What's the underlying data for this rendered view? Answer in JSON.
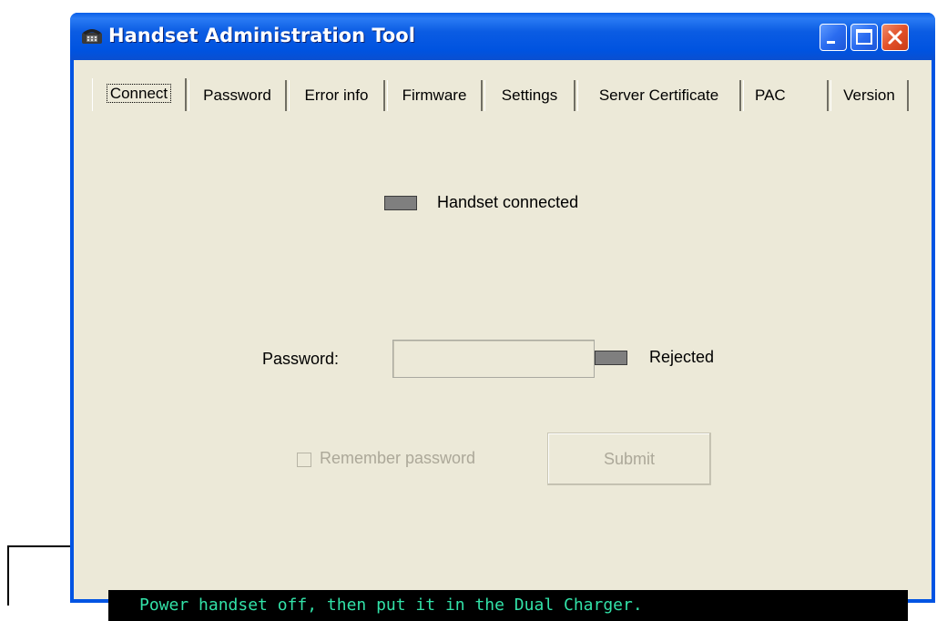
{
  "window": {
    "title": "Handset Administration Tool",
    "icon": "telephone-icon",
    "controls": [
      "minimize-icon",
      "maximize-icon",
      "close-icon"
    ]
  },
  "tabs": [
    {
      "label": "Connect",
      "active": true
    },
    {
      "label": "Password",
      "active": false
    },
    {
      "label": "Error info",
      "active": false
    },
    {
      "label": "Firmware",
      "active": false
    },
    {
      "label": "Settings",
      "active": false
    },
    {
      "label": "Server Certificate",
      "active": false
    },
    {
      "label": "PAC",
      "active": false
    },
    {
      "label": "Version",
      "active": false
    }
  ],
  "connect": {
    "handset_connected_label": "Handset connected",
    "password_label": "Password:",
    "password_value": "",
    "rejected_label": "Rejected",
    "remember_password_label": "Remember password",
    "remember_password_checked": false,
    "submit_label": "Submit"
  },
  "status": {
    "message": "Power handset off, then put it in the Dual Charger."
  },
  "colors": {
    "titlebar": "#0054e3",
    "client_bg": "#ece9d8",
    "led_off": "#7f7f7f",
    "status_text": "#32e2a8",
    "status_bg": "#000000",
    "disabled_text": "#aca899"
  }
}
